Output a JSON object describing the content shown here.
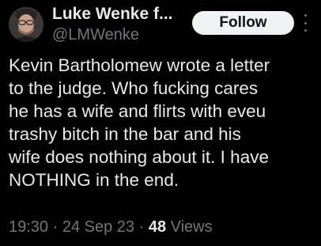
{
  "author": {
    "display_name": "Luke Wenke f...",
    "handle": "@LMWenke"
  },
  "follow_label": "Follow",
  "more_icon": "more-vertical-icon",
  "tweet": {
    "text": "Kevin Bartholomew wrote a letter\nto the judge.  Who fucking cares\nhe has a wife and flirts with eveu\ntrashy bitch in the bar and his\nwife does nothing about it.  I have\nNOTHING in the end."
  },
  "meta": {
    "time": "19:30",
    "separator": " · ",
    "date": "24 Sep 23",
    "views_count": "48",
    "views_label": " Views"
  },
  "colors": {
    "background": "#000000",
    "text": "#e7e9ea",
    "secondary_text": "#71767b",
    "follow_button_bg": "#eff3f4"
  }
}
